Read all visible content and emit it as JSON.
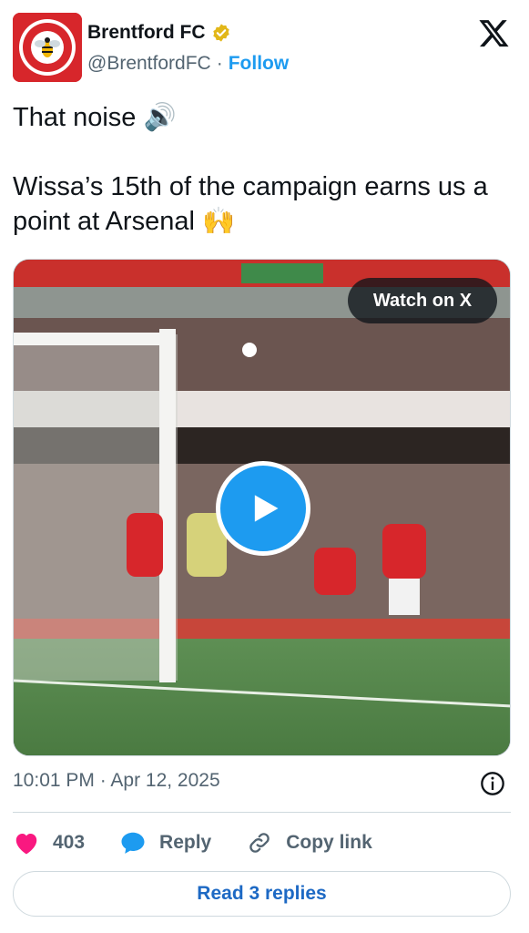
{
  "account": {
    "display_name": "Brentford FC",
    "handle": "@BrentfordFC",
    "separator": "·",
    "follow_label": "Follow",
    "verified_color": "#e2b719",
    "avatar_icon": "brentford-crest"
  },
  "tweet": {
    "line1": "That noise 🔊",
    "line2": "Wissa’s 15th of the campaign earns us a point at Arsenal 🙌"
  },
  "media": {
    "watch_label": "Watch on X",
    "play_icon": "play-icon"
  },
  "meta": {
    "timestamp": "10:01 PM · Apr 12, 2025",
    "info_icon": "info-icon"
  },
  "actions": {
    "like_count": "403",
    "reply_label": "Reply",
    "copy_link_label": "Copy link"
  },
  "footer": {
    "read_replies_label": "Read 3 replies"
  },
  "colors": {
    "accent": "#1d9bf0",
    "like": "#f91880",
    "brand_red": "#d7262b"
  }
}
